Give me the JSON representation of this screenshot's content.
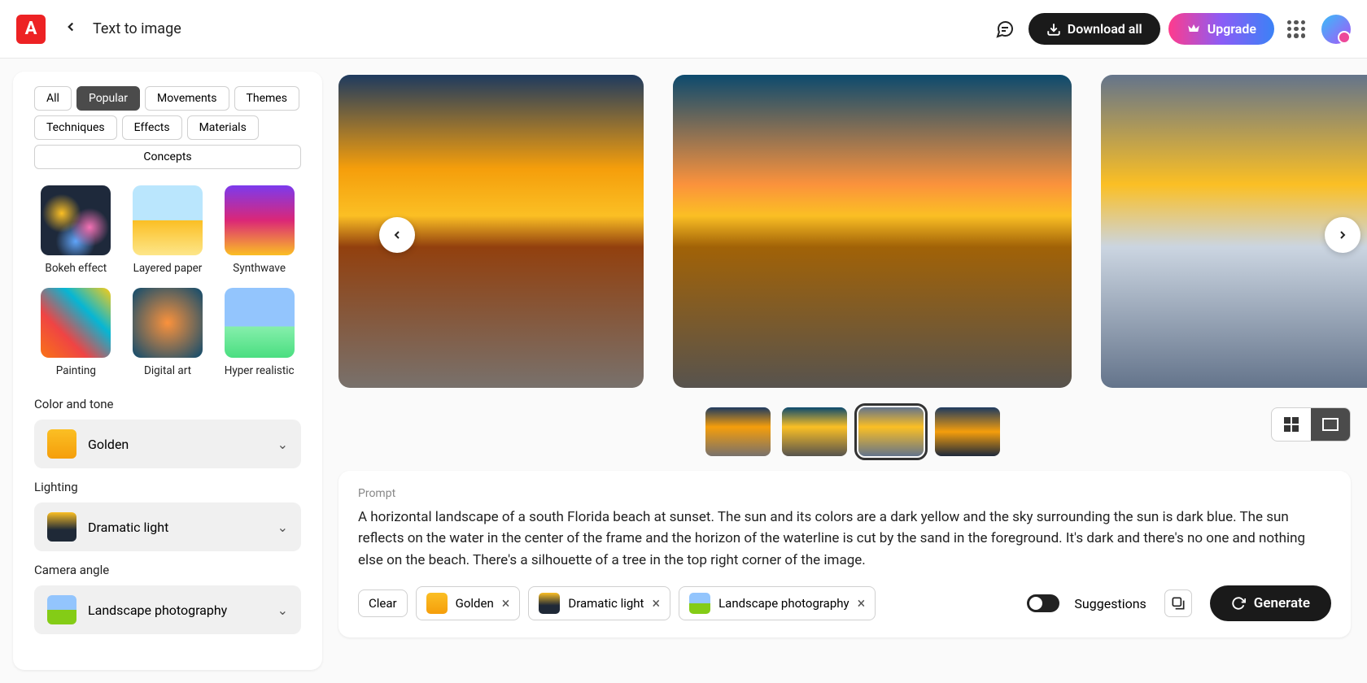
{
  "header": {
    "page_title": "Text to image",
    "download_all": "Download all",
    "upgrade": "Upgrade"
  },
  "sidebar": {
    "filter_tabs": {
      "all": "All",
      "popular": "Popular",
      "movements": "Movements",
      "themes": "Themes",
      "techniques": "Techniques",
      "effects": "Effects",
      "materials": "Materials",
      "concepts": "Concepts"
    },
    "styles": {
      "bokeh": "Bokeh effect",
      "layered": "Layered paper",
      "synthwave": "Synthwave",
      "painting": "Painting",
      "digital": "Digital art",
      "hyper": "Hyper realistic"
    },
    "color_tone": {
      "label": "Color and tone",
      "value": "Golden"
    },
    "lighting": {
      "label": "Lighting",
      "value": "Dramatic light"
    },
    "camera": {
      "label": "Camera angle",
      "value": "Landscape photography"
    }
  },
  "prompt": {
    "label": "Prompt",
    "text": "A horizontal landscape of a south Florida beach at sunset. The sun and its colors are a dark yellow and the sky surrounding the sun is dark blue. The sun reflects on the water in the center of the frame and the horizon of the waterline is cut by the sand in the foreground. It's dark and there's no one and nothing else on the beach. There's a silhouette of a tree in the top right corner of the image.",
    "clear": "Clear",
    "tags": {
      "golden": "Golden",
      "dramatic": "Dramatic light",
      "landscape": "Landscape photography"
    },
    "suggestions": "Suggestions",
    "generate": "Generate"
  },
  "colors": {
    "brand_red": "#ed2224"
  }
}
